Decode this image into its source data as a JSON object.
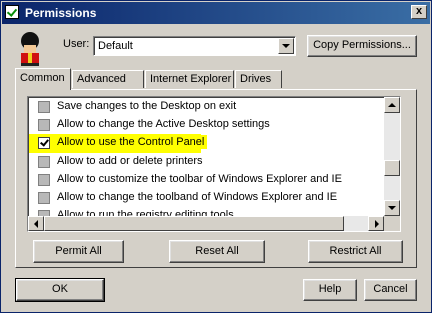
{
  "window": {
    "title": "Permissions",
    "close_label": "x"
  },
  "user": {
    "label": "User:",
    "selected": "Default",
    "copy_button": "Copy Permissions..."
  },
  "tabs": [
    {
      "label": "Common",
      "active": true
    },
    {
      "label": "Advanced",
      "active": false
    },
    {
      "label": "Internet Explorer",
      "active": false
    },
    {
      "label": "Drives",
      "active": false
    }
  ],
  "permissions": [
    {
      "label": "Save changes to the Desktop on exit",
      "checked": false,
      "highlighted": false
    },
    {
      "label": "Allow to change the Active Desktop settings",
      "checked": false,
      "highlighted": false
    },
    {
      "label": "Allow to use the Control Panel",
      "checked": true,
      "highlighted": true
    },
    {
      "label": "Allow to add or delete printers",
      "checked": false,
      "highlighted": false
    },
    {
      "label": "Allow to customize the toolbar of Windows Explorer and IE",
      "checked": false,
      "highlighted": false
    },
    {
      "label": "Allow to change the toolband of Windows Explorer and IE",
      "checked": false,
      "highlighted": false
    },
    {
      "label": "Allow to run the registry editing tools",
      "checked": false,
      "highlighted": false
    }
  ],
  "actions": {
    "permit_all": "Permit All",
    "reset_all": "Reset All",
    "restrict_all": "Restrict All"
  },
  "footer": {
    "ok": "OK",
    "help": "Help",
    "cancel": "Cancel"
  },
  "colors": {
    "highlight": "#ffff00",
    "titlebar": "#0a246a",
    "face": "#d4d0c8"
  }
}
